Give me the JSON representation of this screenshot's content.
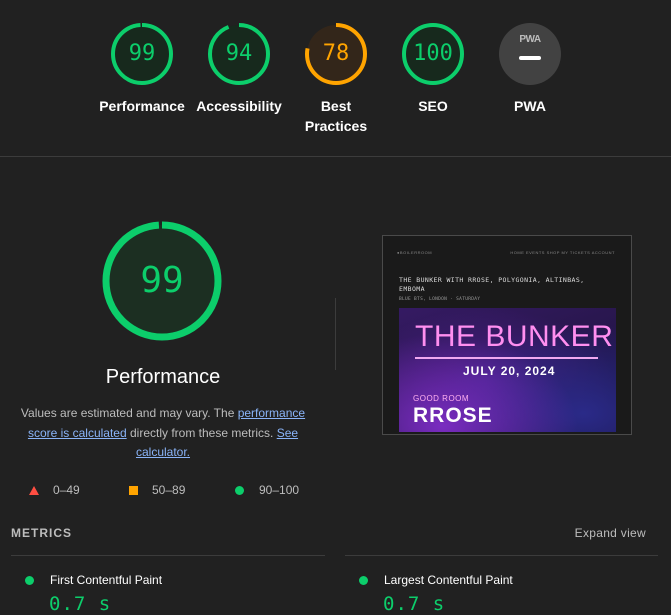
{
  "colors": {
    "pass": "#0cce6b",
    "average": "#ffa400",
    "fail": "#ff4e42",
    "na": "#9e9e9e"
  },
  "categories": [
    {
      "label": "Performance",
      "score": "99",
      "value": 99,
      "status": "pass"
    },
    {
      "label": "Accessibility",
      "score": "94",
      "value": 94,
      "status": "pass"
    },
    {
      "label": "Best Practices",
      "score": "78",
      "value": 78,
      "status": "average"
    },
    {
      "label": "SEO",
      "score": "100",
      "value": 100,
      "status": "pass"
    },
    {
      "label": "PWA",
      "score": "PWA",
      "status": "na",
      "icon": "pwa-icon"
    }
  ],
  "performance": {
    "score": "99",
    "value": 99,
    "title": "Performance",
    "note_prefix": "Values are estimated and may vary. The ",
    "note_link1": "performance score is calculated",
    "note_mid": " directly from these metrics. ",
    "note_link2": "See calculator."
  },
  "legend": [
    {
      "range": "0–49",
      "shape": "triangle"
    },
    {
      "range": "50–89",
      "shape": "square"
    },
    {
      "range": "90–100",
      "shape": "circle"
    }
  ],
  "screenshot": {
    "nav_left": "●BOILERROOM",
    "nav_right": "HOME  EVENTS  SHOP  MY TICKETS  ACCOUNT",
    "heading": "THE BUNKER WITH RROSE, POLYGONIA, ALTINBAS, EMBOMA",
    "subheading": "BLUE BTS, LONDON · SATURDAY",
    "poster_title": "THE BUNKER",
    "poster_date": "JULY 20, 2024",
    "poster_room": "GOOD ROOM",
    "poster_artist": "RROSE"
  },
  "metrics": {
    "title": "METRICS",
    "expand_label": "Expand view",
    "items": [
      {
        "label": "First Contentful Paint",
        "value": "0.7 s"
      },
      {
        "label": "Largest Contentful Paint",
        "value": "0.7 s"
      }
    ]
  }
}
